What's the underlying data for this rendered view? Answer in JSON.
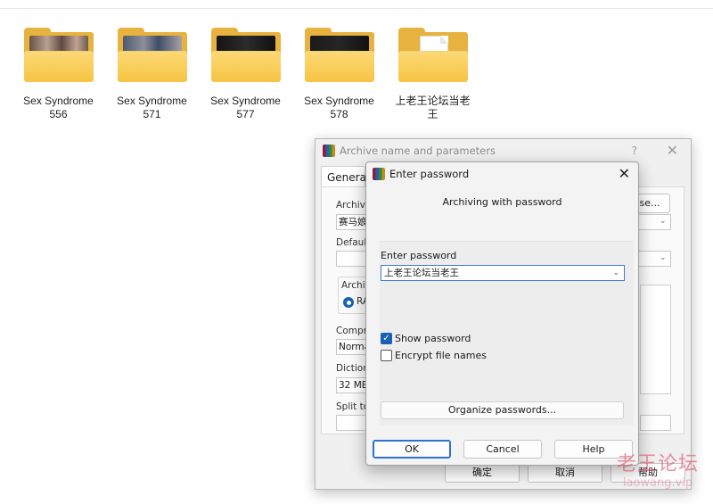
{
  "desktop": {
    "folders": [
      {
        "name": "Sex Syndrome\n556"
      },
      {
        "name": "Sex Syndrome\n571"
      },
      {
        "name": "Sex Syndrome\n577"
      },
      {
        "name": "Sex Syndrome\n578"
      },
      {
        "name": "上老王论坛当老\n王"
      }
    ]
  },
  "archive_dialog": {
    "title": "Archive name and parameters",
    "help_glyph": "?",
    "close_glyph": "✕",
    "tab_general": "General",
    "archive_label": "Archive",
    "archive_value": "赛马娘",
    "browse_label": "se...",
    "default_label": "Default",
    "archive_format_label": "Archiv",
    "rar_label": "RA",
    "compression_label": "Compre",
    "compression_value": "Norma",
    "dictionary_label": "Dictiona",
    "dictionary_value": "32 MB",
    "split_label": "Split to",
    "ok_label": "确定",
    "cancel_label": "取消",
    "help_label": "帮助"
  },
  "password_dialog": {
    "title": "Enter password",
    "close_glyph": "✕",
    "heading": "Archiving with password",
    "enter_password_label": "Enter password",
    "password_value": "上老王论坛当老王",
    "show_password_label": "Show password",
    "show_password_checked": true,
    "encrypt_names_label": "Encrypt file names",
    "encrypt_names_checked": false,
    "organize_label": "Organize passwords...",
    "ok_label": "OK",
    "cancel_label": "Cancel",
    "help_label": "Help",
    "check_glyph": "✓",
    "chevron_glyph": "⌄"
  },
  "watermark": {
    "cn": "老王论坛",
    "en": "laowang.vip"
  }
}
